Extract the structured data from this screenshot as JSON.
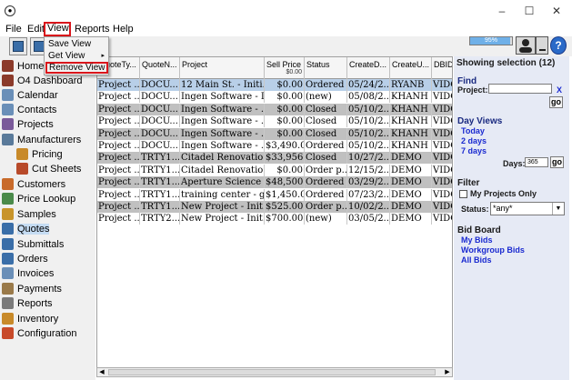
{
  "window": {
    "app_icon": "app-logo-icon",
    "controls": [
      "–",
      "☐",
      "✕"
    ]
  },
  "menubar": {
    "items": [
      "File",
      "Edit",
      "View",
      "Reports",
      "Help"
    ]
  },
  "view_menu": {
    "items": [
      "Save View",
      "Get View",
      "Remove View"
    ],
    "submenu_arrow": "▸"
  },
  "toolbar": {
    "progress_text": "95%",
    "progress_value": 95
  },
  "sidebar": {
    "items": [
      {
        "label": "Home",
        "icon": "home-icon",
        "color": "#8b3a2a"
      },
      {
        "label": "O4 Dashboard",
        "icon": "dashboard-icon",
        "color": "#8b3a2a"
      },
      {
        "label": "Calendar",
        "icon": "calendar-icon",
        "color": "#6a8fb8"
      },
      {
        "label": "Contacts",
        "icon": "contacts-icon",
        "color": "#6a8fb8"
      },
      {
        "label": "Projects",
        "icon": "projects-icon",
        "color": "#7a5a9a"
      },
      {
        "label": "Manufacturers",
        "icon": "manufacturers-icon",
        "color": "#5a7a9a"
      },
      {
        "label": "Pricing",
        "icon": "pricing-icon",
        "color": "#c88a2a"
      },
      {
        "label": "Cut Sheets",
        "icon": "cut-sheets-icon",
        "color": "#b84a2a"
      },
      {
        "label": "Customers",
        "icon": "customers-icon",
        "color": "#c86a2a"
      },
      {
        "label": "Price Lookup",
        "icon": "price-lookup-icon",
        "color": "#4a8a4a"
      },
      {
        "label": "Samples",
        "icon": "samples-icon",
        "color": "#c8942a"
      },
      {
        "label": "Quotes",
        "icon": "quotes-icon",
        "color": "#3a6ea8"
      },
      {
        "label": "Submittals",
        "icon": "submittals-icon",
        "color": "#3a6ea8"
      },
      {
        "label": "Orders",
        "icon": "orders-icon",
        "color": "#3a6ea8"
      },
      {
        "label": "Invoices",
        "icon": "invoices-icon",
        "color": "#6a8fb8"
      },
      {
        "label": "Payments",
        "icon": "payments-icon",
        "color": "#9a7a4a"
      },
      {
        "label": "Reports",
        "icon": "reports-icon",
        "color": "#7a7a7a"
      },
      {
        "label": "Inventory",
        "icon": "inventory-icon",
        "color": "#c88a2a"
      },
      {
        "label": "Configuration",
        "icon": "configuration-icon",
        "color": "#c84a2a"
      }
    ]
  },
  "table": {
    "columns": [
      {
        "label": "QuoteTy..."
      },
      {
        "label": "QuoteN..."
      },
      {
        "label": "Project"
      },
      {
        "label": "Sell Price",
        "sub": "$0.00"
      },
      {
        "label": "Status"
      },
      {
        "label": "CreateD..."
      },
      {
        "label": "CreateU..."
      },
      {
        "label": "DBID"
      }
    ],
    "rows": [
      [
        "Project ...",
        "DOCU...",
        "12 Main St. - Initi...",
        "$0.00",
        "Ordered",
        "05/24/2...",
        "RYANB",
        "VIDC"
      ],
      [
        "Project ...",
        "DOCU...",
        "Ingen Software - I...",
        "$0.00",
        "(new)",
        "05/08/2...",
        "KHANH",
        "VIDC"
      ],
      [
        "Project ...",
        "DOCU...",
        "Ingen Software - ...",
        "$0.00",
        "Closed",
        "05/10/2...",
        "KHANH",
        "VIDC"
      ],
      [
        "Project ...",
        "DOCU...",
        "Ingen Software - ...",
        "$0.00",
        "Closed",
        "05/10/2...",
        "KHANH",
        "VIDC"
      ],
      [
        "Project ...",
        "DOCU...",
        "Ingen Software - ...",
        "$0.00",
        "Closed",
        "05/10/2...",
        "KHANH",
        "VIDC"
      ],
      [
        "Project ...",
        "DOCU...",
        "Ingen Software - ...",
        "$3,490.00",
        "Ordered",
        "05/10/2...",
        "KHANH",
        "VIDC"
      ],
      [
        "Project ...",
        "TRTY1...",
        "Citadel Renovatio...",
        "$33,956...",
        "Closed",
        "10/27/2...",
        "DEMO",
        "VIDC"
      ],
      [
        "Project ...",
        "TRTY1...",
        "Citadel Renovatio...",
        "$0.00",
        "Order p...",
        "12/15/2...",
        "DEMO",
        "VIDC"
      ],
      [
        "Project ...",
        "TRTY1...",
        "Aperture Science -...",
        "$48,500...",
        "Ordered",
        "03/29/2...",
        "DEMO",
        "VIDC"
      ],
      [
        "Project ...",
        "TRTY1...",
        "training center - gym",
        "$1,450.00",
        "Ordered",
        "07/23/2...",
        "DEMO",
        "VIDC"
      ],
      [
        "Project ...",
        "TRTY1...",
        "New Project - Init...",
        "$525.00",
        "Order p...",
        "10/02/2...",
        "DEMO",
        "VIDC"
      ],
      [
        "Project ...",
        "TRTY2...",
        "New Project - Init...",
        "$700.00",
        "(new)",
        "03/05/2...",
        "DEMO",
        "VIDC"
      ]
    ],
    "row_colors": [
      "#b8cfe8",
      "#ffffff",
      "#c0c0c0",
      "#ffffff",
      "#c0c0c0",
      "#ffffff",
      "#c0c0c0",
      "#ffffff",
      "#c0c0c0",
      "#ffffff",
      "#c0c0c0",
      "#ffffff"
    ]
  },
  "right_panel": {
    "header": "Showing selection (12)",
    "find": {
      "title": "Find",
      "project_label": "Project:",
      "project_value": "",
      "clear": "X",
      "go": "go"
    },
    "day_views": {
      "title": "Day Views",
      "links": [
        "Today",
        "2 days",
        "7 days"
      ],
      "days_label": "Days:",
      "days_value": "365",
      "go": "go"
    },
    "filter": {
      "title": "Filter",
      "my_projects_label": "My Projects Only",
      "my_projects_checked": false,
      "status_label": "Status:",
      "status_value": "*any*"
    },
    "bid_board": {
      "title": "Bid Board",
      "links": [
        "My Bids",
        "Workgroup Bids",
        "All Bids"
      ]
    }
  }
}
